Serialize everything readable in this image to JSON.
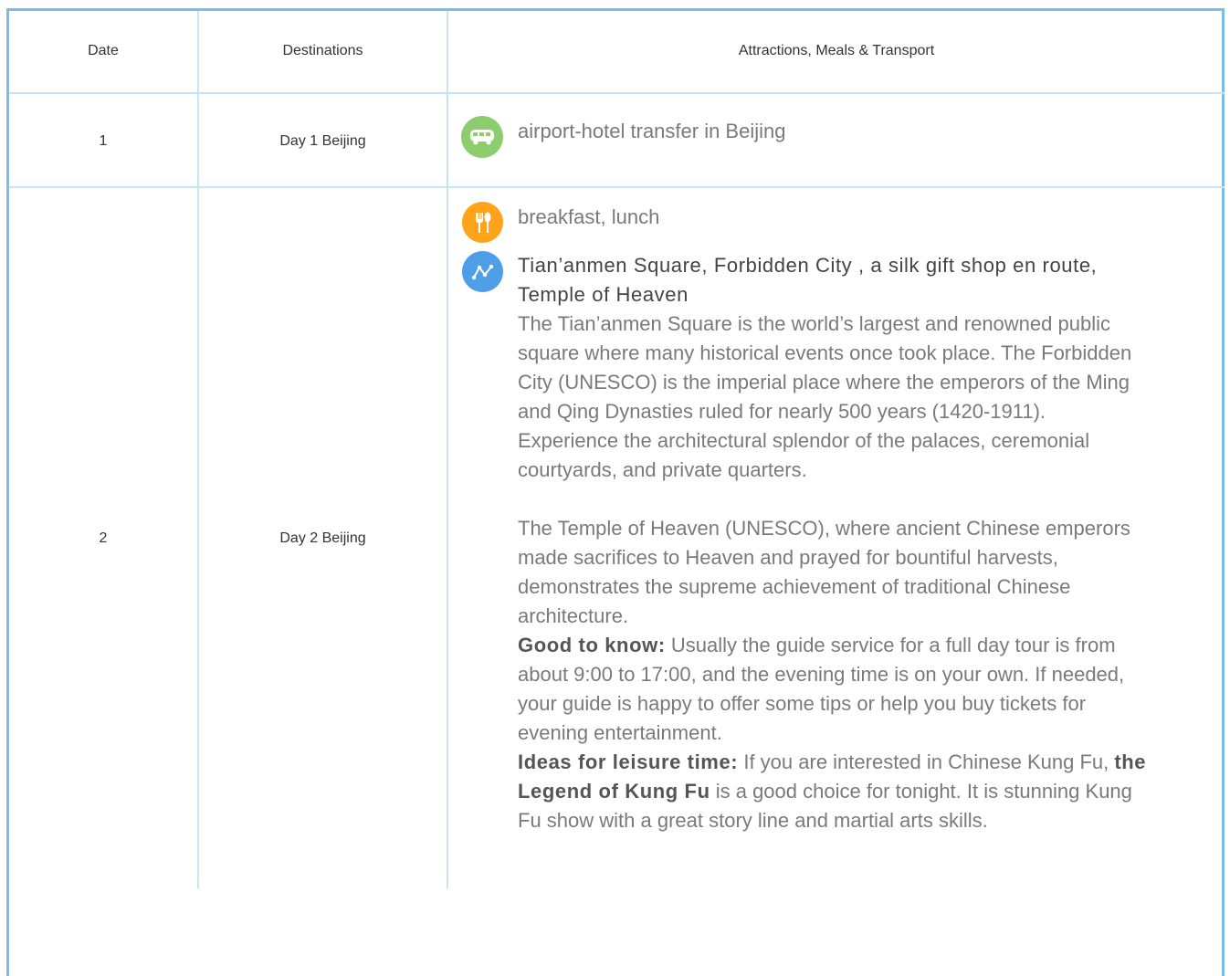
{
  "table": {
    "headers": {
      "date": "Date",
      "destinations": "Destinations",
      "details": "Attractions, Meals & Transport"
    },
    "rows": [
      {
        "date": "1",
        "destination": "Day 1 Beijing",
        "items": [
          {
            "icon": "bus-icon",
            "color": "#8dcd6e",
            "text": "airport-hotel transfer in Beijing"
          }
        ]
      },
      {
        "date": "2",
        "destination": "Day 2 Beijing",
        "meals": {
          "icon": "fork-knife-icon",
          "color": "#ffa31a",
          "text": "breakfast, lunch"
        },
        "route": {
          "icon": "route-icon",
          "color": "#4f9ee8",
          "title": "Tian’anmen Square, Forbidden City , a silk gift shop en route, Temple of Heaven",
          "para1": "The Tian’anmen Square is the world’s largest and renowned public square where many historical events once took place. The Forbidden City (UNESCO) is the imperial place where the emperors of the Ming and Qing Dynasties ruled for nearly 500 years (1420-1911). Experience the architectural splendor of the palaces, ceremonial courtyards, and private quarters.",
          "para2": "The Temple of Heaven (UNESCO), where ancient Chinese emperors made sacrifices to Heaven and prayed for bountiful harvests, demonstrates the supreme achievement of traditional Chinese architecture.",
          "good_label": "Good to know:",
          "good_text": " Usually the guide service for a full day tour is from about 9:00 to 17:00, and the evening time is on your own. If needed, your guide is happy to offer some tips or help you buy tickets for evening entertainment.",
          "ideas_label": "Ideas for leisure time:",
          "ideas_pre": " If you are interested in Chinese Kung Fu, ",
          "ideas_bold": "the Legend of Kung Fu",
          "ideas_post": " is a good choice for tonight. It is stunning Kung Fu show with a great story line and martial arts skills."
        }
      }
    ]
  }
}
